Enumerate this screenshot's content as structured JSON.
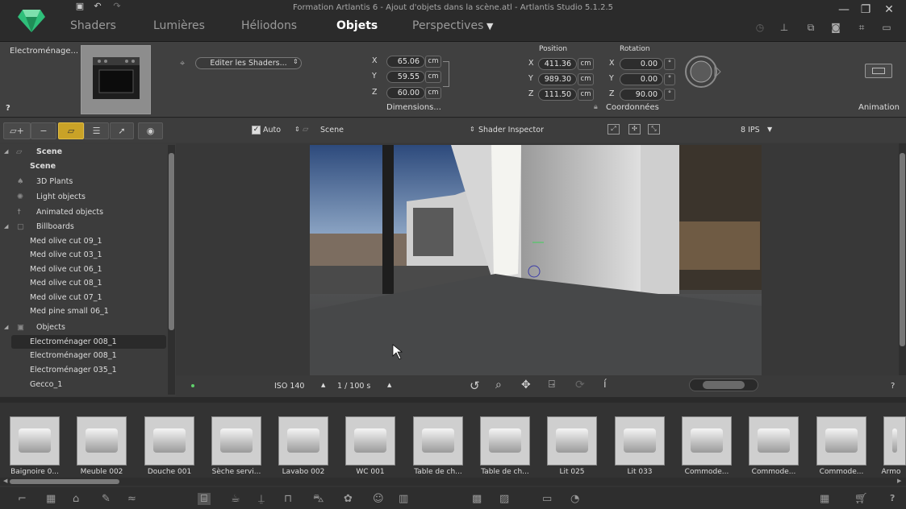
{
  "window": {
    "title": "Formation Artlantis 6 - Ajout d'objets dans la scène.atl - Artlantis Studio 5.1.2.5",
    "tabs": [
      "Shaders",
      "Lumières",
      "Héliodons",
      "Objets",
      "Perspectives"
    ],
    "active_tab": "Objets",
    "min_label": "—",
    "restore_label": "❐",
    "close_label": "✕"
  },
  "inspector": {
    "object_name": "Electroménage...",
    "help": "?",
    "shader_select": "Editer les Shaders...",
    "dimensions": {
      "label": "Dimensions...",
      "x": "65.06",
      "y": "59.55",
      "z": "60.00",
      "unit": "cm"
    },
    "position": {
      "label": "Position",
      "x": "411.36",
      "y": "989.30",
      "z": "111.50",
      "unit": "cm"
    },
    "rotation": {
      "label": "Rotation",
      "x": "0.00",
      "y": "0.00",
      "z": "90.00",
      "unit": "°"
    },
    "coords_label": "Coordonnées",
    "animation_label": "Animation"
  },
  "toolbar": {
    "auto_label": "Auto",
    "scene_label": "Scene",
    "shader_inspector_label": "Shader Inspector",
    "ips_label": "8 IPS"
  },
  "tree": {
    "scene_header": "Scene",
    "scene_item": "Scene",
    "plants": "3D Plants",
    "lights": "Light objects",
    "animated": "Animated objects",
    "billboards_header": "Billboards",
    "billboards": [
      "Med olive cut 09_1",
      "Med olive cut 03_1",
      "Med olive cut 06_1",
      "Med olive cut 08_1",
      "Med olive cut 07_1",
      "Med pine small 06_1"
    ],
    "objects_header": "Objects",
    "objects": [
      "Electroménager 008_1",
      "Electroménager 008_1",
      "Electroménager 035_1",
      "Gecco_1"
    ]
  },
  "viewport_bar": {
    "iso": "ISO 140",
    "shutter": "1 / 100 s",
    "help": "?"
  },
  "library": {
    "items": [
      "Baignoire 0...",
      "Meuble 002",
      "Douche 001",
      "Sèche servi...",
      "Lavabo 002",
      "WC 001",
      "Table de ch...",
      "Table de ch...",
      "Lit 025",
      "Lit 033",
      "Commode...",
      "Commode...",
      "Commode...",
      "Armo"
    ]
  },
  "colors": {
    "accent_logo": "#2fbf7a",
    "selection": "#2a2a2a",
    "toolbar_active": "#c9a227"
  },
  "icons": {
    "logo": "emerald-logo-icon",
    "help": "question-icon",
    "cart": "cart-icon",
    "grid": "grid-icon"
  }
}
